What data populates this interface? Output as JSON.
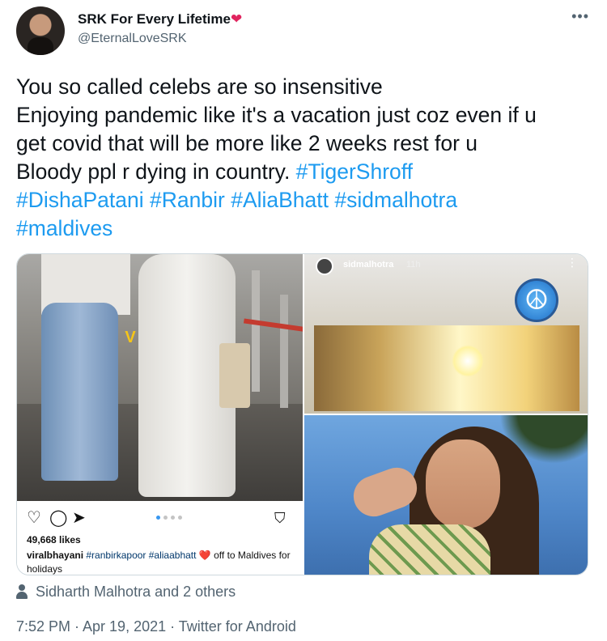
{
  "user": {
    "display_name": "SRK For Every Lifetime",
    "heart": "❤",
    "handle": "@EternalLoveSRK"
  },
  "more_icon": "more-horizontal-icon",
  "tweet": {
    "line1": "You so called celebs are so insensitive",
    "line2": "Enjoying pandemic like it's a vacation just coz even if u",
    "line3": "get covid that will be more like 2 weeks rest for u",
    "line4_text": "Bloody ppl r dying in country. ",
    "hashtags": [
      "#TigerShroff",
      "#DishaPatani",
      "#Ranbir",
      "#AliaBhatt",
      "#sidmalhotra",
      "#maldives"
    ]
  },
  "media": {
    "instagram": {
      "likes": "49,668 likes",
      "caption_user": "viralbhayani",
      "caption_tags": "#ranbirkapoor #aliaabhatt",
      "caption_heart": "❤️",
      "caption_text": " off to Maldives for holidays",
      "watermark_text": "V"
    },
    "story": {
      "user": "sidmalhotra",
      "time": "11h",
      "sticker": "☮"
    }
  },
  "tagged_people": "Sidharth Malhotra and 2 others",
  "meta": "7:52 PM · Apr 19, 2021 · Twitter for Android",
  "colors": {
    "link": "#1d9bf0",
    "secondary_text": "#536471",
    "heart": "#e0245e"
  }
}
